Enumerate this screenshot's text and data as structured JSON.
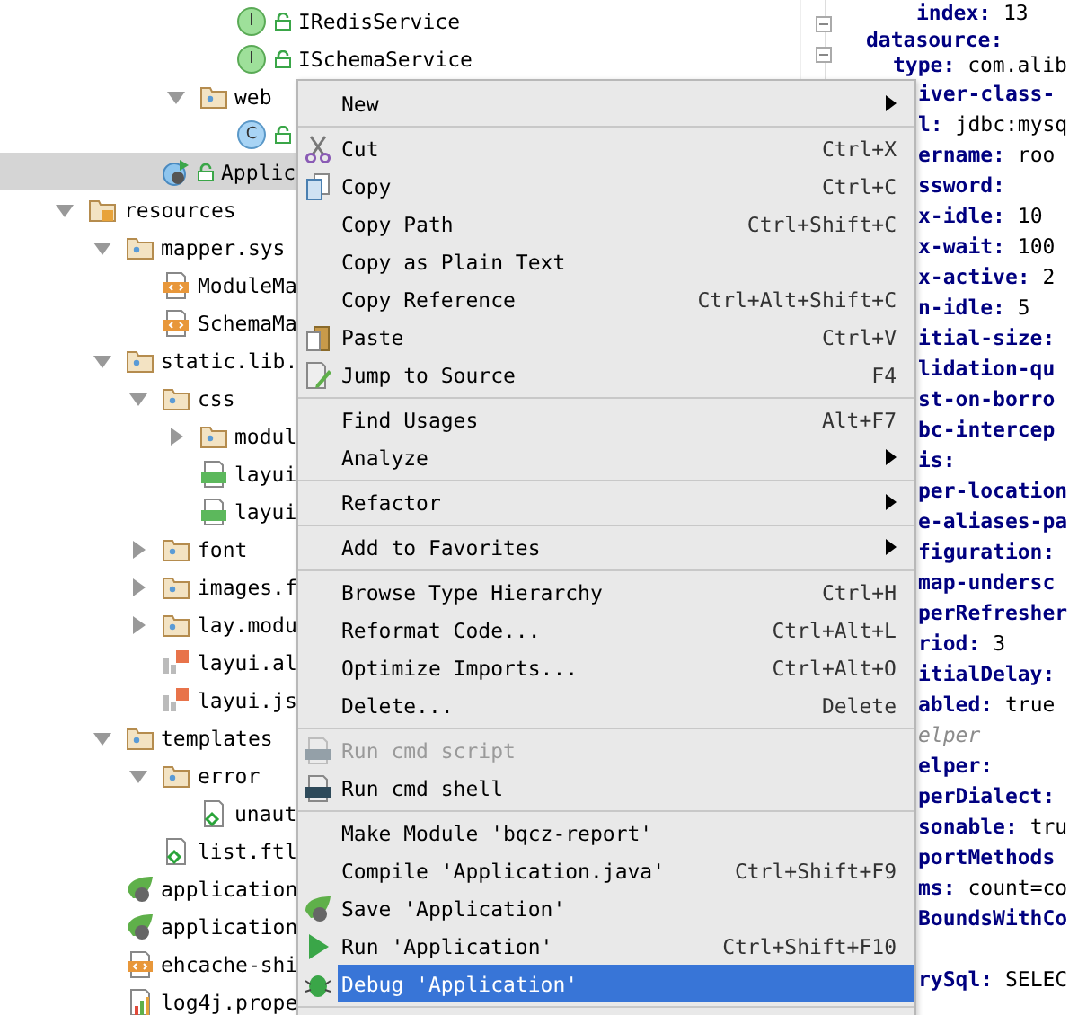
{
  "tree": {
    "items": [
      {
        "children": [
          {
            "children": [
              {
                "children": [
                  {
                    "children": [
                      {
                        "kind": "interface",
                        "badge": "I",
                        "label": "IRedisService",
                        "selected": false
                      },
                      {
                        "kind": "interface",
                        "badge": "I",
                        "label": "ISchemaService",
                        "selected": false
                      }
                    ]
                  },
                  {
                    "kind": "package",
                    "label": "web",
                    "expanded": true,
                    "selected": false,
                    "children": [
                      {
                        "kind": "class",
                        "badge": "C",
                        "selected": false
                      }
                    ]
                  }
                ]
              },
              {
                "kind": "app",
                "label": "Applic",
                "selected": true
              }
            ]
          }
        ]
      },
      {
        "kind": "resources",
        "label": "resources",
        "expanded": true,
        "selected": false,
        "children": [
          {
            "kind": "package",
            "label": "mapper.sys",
            "expanded": true,
            "selected": false,
            "children": [
              {
                "kind": "xml",
                "label": "ModuleMa",
                "selected": false
              },
              {
                "kind": "xml",
                "label": "SchemaMa",
                "selected": false
              }
            ]
          },
          {
            "kind": "package",
            "label": "static.lib.",
            "expanded": true,
            "selected": false,
            "children": [
              {
                "kind": "package",
                "label": "css",
                "expanded": true,
                "selected": false,
                "children": [
                  {
                    "kind": "package",
                    "label": "modul",
                    "expanded": false,
                    "selected": false
                  },
                  {
                    "kind": "css",
                    "label": "layui",
                    "selected": false
                  },
                  {
                    "kind": "css",
                    "label": "layui",
                    "selected": false
                  }
                ]
              },
              {
                "kind": "package",
                "label": "font",
                "expanded": false,
                "selected": false
              },
              {
                "kind": "package",
                "label": "images.f",
                "expanded": false,
                "selected": false
              },
              {
                "kind": "package",
                "label": "lay.modu",
                "expanded": false,
                "selected": false
              },
              {
                "kind": "js",
                "label": "layui.al",
                "selected": false
              },
              {
                "kind": "js",
                "label": "layui.js",
                "selected": false
              }
            ]
          },
          {
            "kind": "package",
            "label": "templates",
            "expanded": true,
            "selected": false,
            "children": [
              {
                "kind": "package",
                "label": "error",
                "expanded": true,
                "selected": false,
                "children": [
                  {
                    "kind": "ftl",
                    "label": "unaut",
                    "selected": false
                  }
                ]
              },
              {
                "kind": "ftl",
                "label": "list.ftl",
                "selected": false
              }
            ]
          },
          {
            "kind": "spring",
            "label": "application",
            "selected": false
          },
          {
            "kind": "spring",
            "label": "application",
            "selected": false
          },
          {
            "kind": "xml",
            "label": "ehcache-shi",
            "selected": false
          },
          {
            "kind": "properties",
            "label": "log4j.prope",
            "selected": false
          }
        ]
      }
    ]
  },
  "editor": {
    "lines": [
      {
        "kind": "code",
        "key": "index:",
        "value": "13"
      },
      {
        "kind": "code",
        "key": "datasource:"
      },
      {
        "kind": "code",
        "key": "type:",
        "value": "com.alib"
      }
    ],
    "lines_beside_menu": [
      {
        "kind": "code",
        "key": "iver-class-"
      },
      {
        "kind": "code",
        "key": "l:",
        "value": "jdbc:mysq"
      },
      {
        "kind": "code",
        "key": "ername:",
        "value": "roo"
      },
      {
        "kind": "code",
        "key": "ssword:"
      },
      {
        "kind": "code",
        "key": "x-idle:",
        "value": "10"
      },
      {
        "kind": "code",
        "key": "x-wait:",
        "value": "100"
      },
      {
        "kind": "code",
        "key": "x-active:",
        "value": "2"
      },
      {
        "kind": "code",
        "key": "n-idle:",
        "value": "5"
      },
      {
        "kind": "code",
        "key": "itial-size:"
      },
      {
        "kind": "code",
        "key": "lidation-qu"
      },
      {
        "kind": "code",
        "key": "st-on-borro"
      },
      {
        "kind": "code",
        "key": "bc-intercep"
      },
      {
        "kind": "code",
        "key": "is:"
      },
      {
        "kind": "code",
        "key": "per-location"
      },
      {
        "kind": "code",
        "key": "e-aliases-pa"
      },
      {
        "kind": "code",
        "key": "figuration:"
      },
      {
        "kind": "code",
        "key": "map-undersc"
      },
      {
        "kind": "code",
        "key": "perRefresher"
      },
      {
        "kind": "code",
        "key": "riod:",
        "value": "3"
      },
      {
        "kind": "code",
        "key": "itialDelay:"
      },
      {
        "kind": "code",
        "key": "abled:",
        "value": "true"
      },
      {
        "kind": "comment",
        "key": "elper"
      },
      {
        "kind": "code",
        "key": "elper:"
      },
      {
        "kind": "code",
        "key": "perDialect:"
      },
      {
        "kind": "code",
        "key": "sonable:",
        "value": "tru"
      },
      {
        "kind": "code",
        "key": "portMethods"
      },
      {
        "kind": "code",
        "key": "ms:",
        "value": "count=co"
      },
      {
        "kind": "code",
        "key": "BoundsWithCo"
      },
      {
        "kind": "blank"
      },
      {
        "kind": "code",
        "key": "rySql:",
        "value": "SELEC"
      }
    ]
  },
  "context_menu": {
    "items": [
      {
        "kind": "plain",
        "label": "New",
        "submenu": true,
        "disabled": false,
        "selected": false
      },
      {
        "kind": "separator"
      },
      {
        "kind": "cut",
        "label": "Cut",
        "shortcut": "Ctrl+X",
        "disabled": false,
        "selected": false
      },
      {
        "kind": "copy",
        "label": "Copy",
        "shortcut": "Ctrl+C",
        "disabled": false,
        "selected": false
      },
      {
        "kind": "plain",
        "label": "Copy Path",
        "shortcut": "Ctrl+Shift+C",
        "disabled": false,
        "selected": false
      },
      {
        "kind": "plain",
        "label": "Copy as Plain Text",
        "disabled": false,
        "selected": false
      },
      {
        "kind": "plain",
        "label": "Copy Reference",
        "shortcut": "Ctrl+Alt+Shift+C",
        "disabled": false,
        "selected": false
      },
      {
        "kind": "paste",
        "label": "Paste",
        "shortcut": "Ctrl+V",
        "disabled": false,
        "selected": false
      },
      {
        "kind": "jump",
        "label": "Jump to Source",
        "shortcut": "F4",
        "disabled": false,
        "selected": false
      },
      {
        "kind": "separator"
      },
      {
        "kind": "plain",
        "label": "Find Usages",
        "shortcut": "Alt+F7",
        "disabled": false,
        "selected": false
      },
      {
        "kind": "plain",
        "label": "Analyze",
        "submenu": true,
        "disabled": false,
        "selected": false
      },
      {
        "kind": "separator"
      },
      {
        "kind": "plain",
        "label": "Refactor",
        "submenu": true,
        "disabled": false,
        "selected": false
      },
      {
        "kind": "separator"
      },
      {
        "kind": "plain",
        "label": "Add to Favorites",
        "submenu": true,
        "disabled": false,
        "selected": false
      },
      {
        "kind": "separator"
      },
      {
        "kind": "plain",
        "label": "Browse Type Hierarchy",
        "shortcut": "Ctrl+H",
        "disabled": false,
        "selected": false
      },
      {
        "kind": "plain",
        "label": "Reformat Code...",
        "shortcut": "Ctrl+Alt+L",
        "disabled": false,
        "selected": false
      },
      {
        "kind": "plain",
        "label": "Optimize Imports...",
        "shortcut": "Ctrl+Alt+O",
        "disabled": false,
        "selected": false
      },
      {
        "kind": "plain",
        "label": "Delete...",
        "shortcut": "Delete",
        "disabled": false,
        "selected": false
      },
      {
        "kind": "separator"
      },
      {
        "kind": "cmd",
        "label": "Run cmd script",
        "disabled": true,
        "selected": false
      },
      {
        "kind": "cmd",
        "label": "Run cmd shell",
        "disabled": false,
        "selected": false
      },
      {
        "kind": "separator"
      },
      {
        "kind": "plain",
        "label": "Make Module 'bqcz-report'",
        "disabled": false,
        "selected": false
      },
      {
        "kind": "plain",
        "label": "Compile 'Application.java'",
        "shortcut": "Ctrl+Shift+F9",
        "disabled": false,
        "selected": false
      },
      {
        "kind": "spring",
        "label": "Save 'Application'",
        "disabled": false,
        "selected": false
      },
      {
        "kind": "run",
        "label": "Run 'Application'",
        "shortcut": "Ctrl+Shift+F10",
        "disabled": false,
        "selected": false
      },
      {
        "kind": "debug",
        "label": "Debug 'Application'",
        "disabled": false,
        "selected": true
      },
      {
        "kind": "separator"
      }
    ]
  }
}
